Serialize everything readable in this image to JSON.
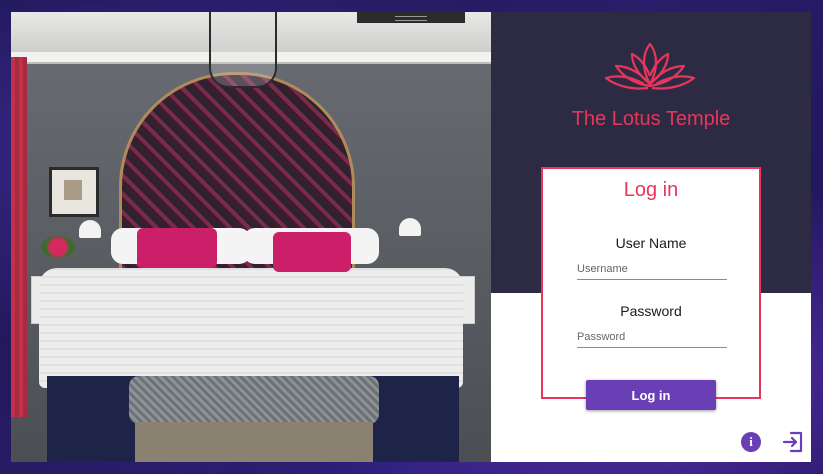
{
  "brand": {
    "name": "The Lotus Temple",
    "accent": "#e8355c",
    "panel_color": "#2c2b43"
  },
  "login": {
    "title": "Log in",
    "username_label": "User Name",
    "username_placeholder": "Username",
    "password_label": "Password",
    "password_placeholder": "Password",
    "button_label": "Log in",
    "button_color": "#6a3fb5"
  },
  "footer": {
    "info_icon": "info-icon",
    "info_glyph": "i",
    "exit_icon": "exit-icon"
  },
  "photo": {
    "icon": "bedroom-photo"
  }
}
